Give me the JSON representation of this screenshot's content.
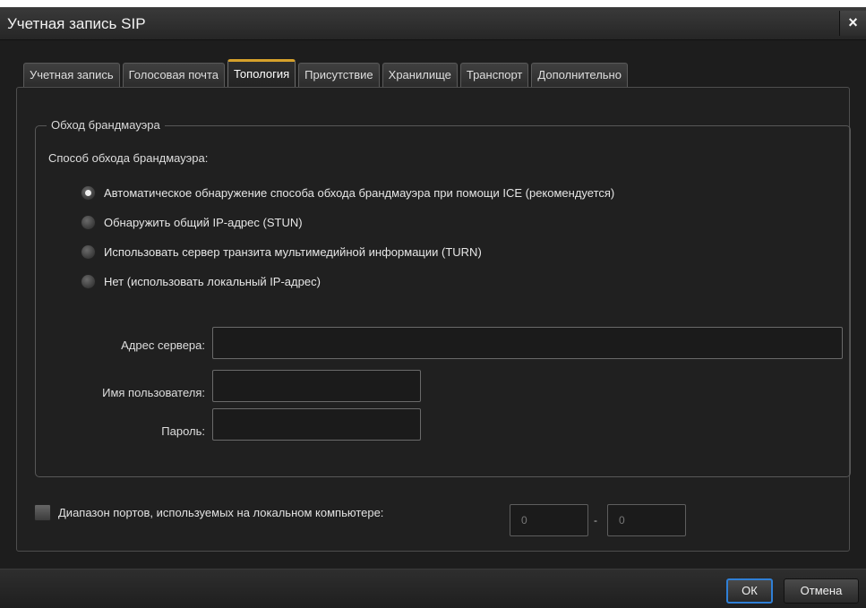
{
  "window": {
    "title": "Учетная запись SIP",
    "close_symbol": "×"
  },
  "tabs": [
    {
      "label": "Учетная запись",
      "active": false
    },
    {
      "label": "Голосовая почта",
      "active": false
    },
    {
      "label": "Топология",
      "active": true
    },
    {
      "label": "Присутствие",
      "active": false
    },
    {
      "label": "Хранилище",
      "active": false
    },
    {
      "label": "Транспорт",
      "active": false
    },
    {
      "label": "Дополнительно",
      "active": false
    }
  ],
  "firewall": {
    "group_title": "Обход брандмауэра",
    "method_label": "Способ обхода брандмауэра:",
    "options": [
      {
        "label": "Автоматическое обнаружение способа обхода брандмауэра при помощи ICE (рекомендуется)",
        "checked": true
      },
      {
        "label": "Обнаружить общий IP-адрес (STUN)",
        "checked": false
      },
      {
        "label": "Использовать сервер транзита мультимедийной информации (TURN)",
        "checked": false
      },
      {
        "label": "Нет (использовать локальный IP-адрес)",
        "checked": false
      }
    ],
    "server_address_label": "Адрес сервера:",
    "server_address_value": "",
    "username_label": "Имя пользователя:",
    "username_value": "",
    "password_label": "Пароль:",
    "password_value": ""
  },
  "ports": {
    "label": "Диапазон портов, используемых на локальном компьютере:",
    "checked": false,
    "from_value": "0",
    "separator": "-",
    "to_value": "0"
  },
  "footer": {
    "ok_label": "ОК",
    "cancel_label": "Отмена"
  },
  "colors": {
    "active_tab_accent": "#d6a12b",
    "primary_button_border": "#2f7fd6",
    "dialog_background": "#1d1d1d"
  }
}
